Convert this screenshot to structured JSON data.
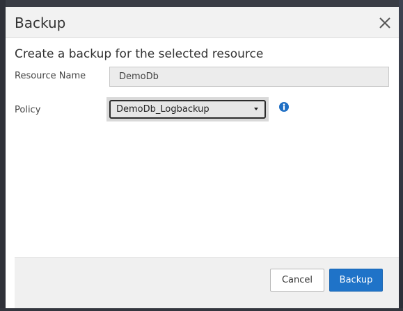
{
  "dialog": {
    "title": "Backup",
    "subtitle": "Create a backup for the selected resource"
  },
  "form": {
    "resource_name_label": "Resource Name",
    "resource_name_value": "DemoDb",
    "policy_label": "Policy",
    "policy_selected": "DemoDb_Logbackup"
  },
  "footer": {
    "cancel_label": "Cancel",
    "backup_label": "Backup"
  },
  "icons": {
    "close": "close-icon",
    "info": "info-icon",
    "dropdown": "caret-down-icon"
  },
  "colors": {
    "primary": "#1f73c8",
    "info": "#1f6fc4",
    "header_bg": "#f2f2f2",
    "footer_bg": "#f0f0f0"
  }
}
